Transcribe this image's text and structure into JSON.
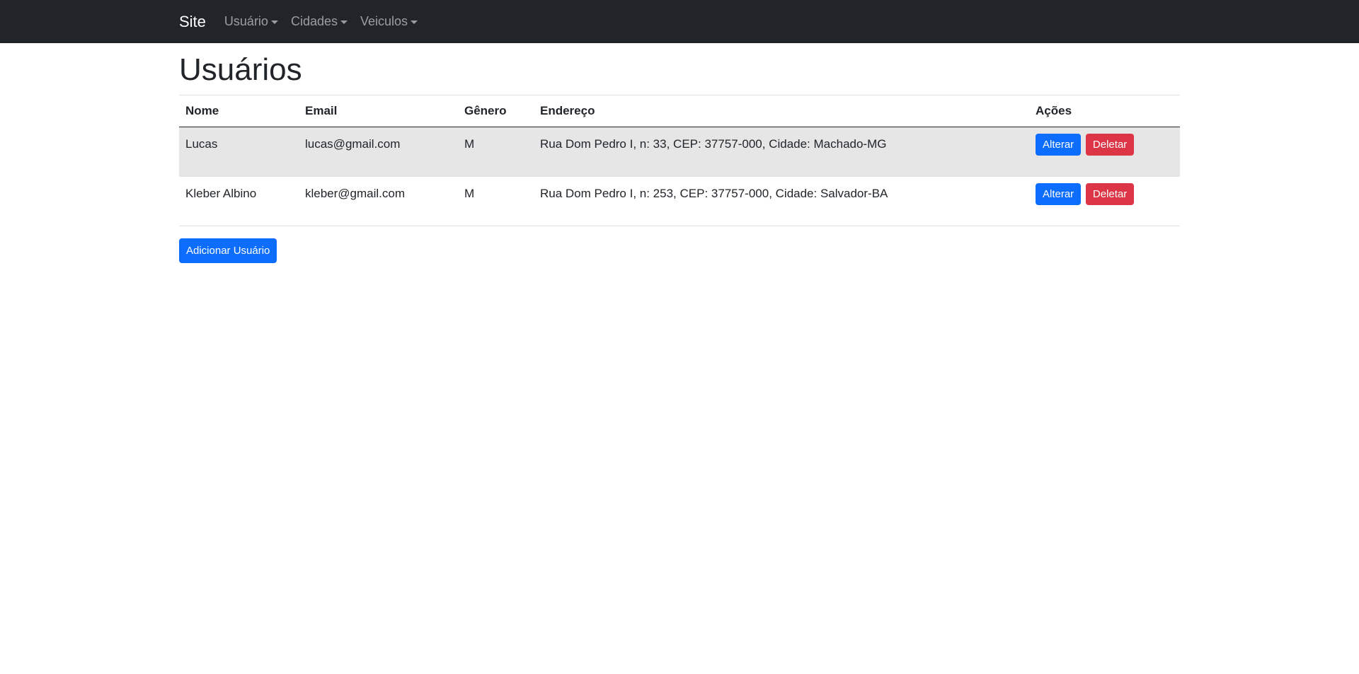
{
  "navbar": {
    "brand": "Site",
    "items": [
      {
        "label": "Usuário"
      },
      {
        "label": "Cidades"
      },
      {
        "label": "Veiculos"
      }
    ]
  },
  "page": {
    "title": "Usuários"
  },
  "table": {
    "headers": {
      "nome": "Nome",
      "email": "Email",
      "genero": "Gênero",
      "endereco": "Endereço",
      "acoes": "Ações"
    },
    "rows": [
      {
        "nome": "Lucas",
        "email": "lucas@gmail.com",
        "genero": "M",
        "endereco": "Rua Dom Pedro I, n: 33, CEP: 37757-000, Cidade: Machado-MG",
        "alterar": "Alterar",
        "deletar": "Deletar"
      },
      {
        "nome": "Kleber Albino",
        "email": "kleber@gmail.com",
        "genero": "M",
        "endereco": "Rua Dom Pedro I, n: 253, CEP: 37757-000, Cidade: Salvador-BA",
        "alterar": "Alterar",
        "deletar": "Deletar"
      }
    ]
  },
  "actions": {
    "add_label": "Adicionar Usuário"
  },
  "colors": {
    "navbar": "#212529",
    "primary": "#0d6efd",
    "danger": "#dc3545",
    "stripe": "#e6e6e6"
  }
}
